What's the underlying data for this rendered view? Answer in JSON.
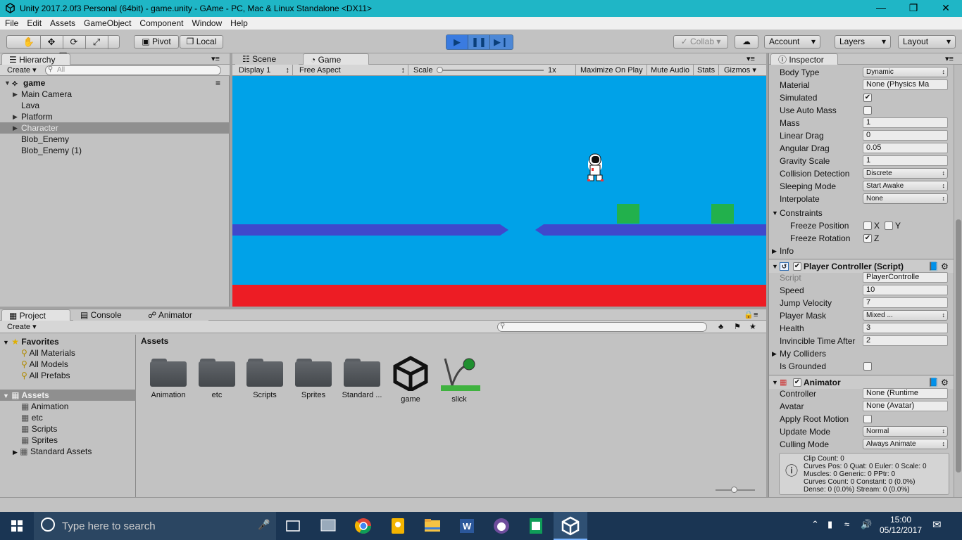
{
  "window": {
    "title": "Unity 2017.2.0f3 Personal (64bit) - game.unity - GAme - PC, Mac & Linux Standalone <DX11>"
  },
  "menu": [
    "File",
    "Edit",
    "Assets",
    "GameObject",
    "Component",
    "Window",
    "Help"
  ],
  "toolbar": {
    "pivot": "Pivot",
    "local": "Local",
    "collab": "Collab",
    "account": "Account",
    "layers": "Layers",
    "layout": "Layout"
  },
  "hierarchy": {
    "tab": "Hierarchy",
    "create": "Create",
    "search_placeholder": "All",
    "scene": "game",
    "items": [
      "Main Camera",
      "Lava",
      "Platform",
      "Character",
      "Blob_Enemy",
      "Blob_Enemy (1)"
    ]
  },
  "game_view": {
    "tab_scene": "Scene",
    "tab_game": "Game",
    "display": "Display 1",
    "aspect": "Free Aspect",
    "scale_label": "Scale",
    "scale_value": "1x",
    "maximize": "Maximize On Play",
    "mute": "Mute Audio",
    "stats": "Stats",
    "gizmos": "Gizmos",
    "colors": {
      "sky": "#00a2e8",
      "lava": "#ed1c24",
      "platform": "#3f48cc",
      "enemy": "#22b14c"
    }
  },
  "project": {
    "tabs": [
      "Project",
      "Console",
      "Animator"
    ],
    "create": "Create",
    "favorites_label": "Favorites",
    "favorites": [
      "All Materials",
      "All Models",
      "All Prefabs"
    ],
    "assets_label": "Assets",
    "asset_folders": [
      "Animation",
      "etc",
      "Scripts",
      "Sprites",
      "Standard Assets"
    ],
    "main_header": "Assets",
    "main_items": [
      "Animation",
      "etc",
      "Scripts",
      "Sprites",
      "Standard ...",
      "game",
      "slick"
    ]
  },
  "inspector": {
    "tab": "Inspector",
    "rigidbody": [
      {
        "label": "Body Type",
        "value": "Dynamic",
        "kind": "dropdown"
      },
      {
        "label": "Material",
        "value": "None (Physics Ma",
        "kind": "field"
      },
      {
        "label": "Simulated",
        "value": "✔",
        "kind": "check"
      },
      {
        "label": "Use Auto Mass",
        "value": "",
        "kind": "check"
      },
      {
        "label": "Mass",
        "value": "1",
        "kind": "field"
      },
      {
        "label": "Linear Drag",
        "value": "0",
        "kind": "field"
      },
      {
        "label": "Angular Drag",
        "value": "0.05",
        "kind": "field"
      },
      {
        "label": "Gravity Scale",
        "value": "1",
        "kind": "field"
      },
      {
        "label": "Collision Detection",
        "value": "Discrete",
        "kind": "dropdown"
      },
      {
        "label": "Sleeping Mode",
        "value": "Start Awake",
        "kind": "dropdown"
      },
      {
        "label": "Interpolate",
        "value": "None",
        "kind": "dropdown"
      }
    ],
    "constraints_label": "Constraints",
    "freeze_position_label": "Freeze Position",
    "freeze_rotation_label": "Freeze Rotation",
    "x_label": "X",
    "y_label": "Y",
    "z_label": "Z",
    "info_label": "Info",
    "player_controller": {
      "title": "Player Controller (Script)",
      "fields": [
        {
          "label": "Script",
          "value": "PlayerControlle",
          "kind": "field"
        },
        {
          "label": "Speed",
          "value": "10",
          "kind": "field"
        },
        {
          "label": "Jump Velocity",
          "value": "7",
          "kind": "field"
        },
        {
          "label": "Player Mask",
          "value": "Mixed ...",
          "kind": "dropdown"
        },
        {
          "label": "Health",
          "value": "3",
          "kind": "field"
        },
        {
          "label": "Invincible Time After",
          "value": "2",
          "kind": "field"
        }
      ],
      "my_colliders": "My Colliders",
      "is_grounded": "Is Grounded"
    },
    "animator": {
      "title": "Animator",
      "fields": [
        {
          "label": "Controller",
          "value": "None (Runtime",
          "kind": "field"
        },
        {
          "label": "Avatar",
          "value": "None (Avatar)",
          "kind": "field"
        },
        {
          "label": "Apply Root Motion",
          "value": "",
          "kind": "check"
        },
        {
          "label": "Update Mode",
          "value": "Normal",
          "kind": "dropdown"
        },
        {
          "label": "Culling Mode",
          "value": "Always Animate",
          "kind": "dropdown"
        }
      ],
      "info": [
        "Clip Count: 0",
        "Curves Pos: 0 Quat: 0 Euler: 0 Scale: 0",
        "Muscles: 0 Generic: 0 PPtr: 0",
        "Curves Count: 0 Constant: 0 (0.0%)",
        "Dense: 0 (0.0%) Stream: 0 (0.0%)"
      ]
    }
  },
  "taskbar": {
    "search_placeholder": "Type here to search",
    "time": "15:00",
    "date": "05/12/2017"
  }
}
